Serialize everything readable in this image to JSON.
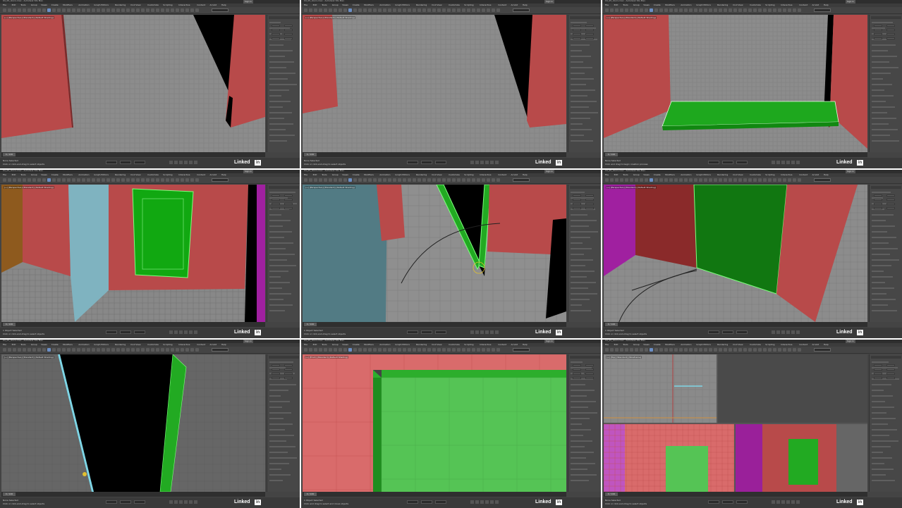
{
  "app": {
    "title": "04_05_doors.max - Autodesk 3ds Max",
    "sign_in": "Sign In",
    "workspace_label": "Workspaces: Default"
  },
  "menus": [
    "File",
    "Edit",
    "Tools",
    "Group",
    "Views",
    "Create",
    "Modifiers",
    "Animation",
    "Graph Editors",
    "Rendering",
    "Civil View",
    "Customize",
    "Scripting",
    "Interactive",
    "Content",
    "Arnold",
    "Help"
  ],
  "viewport_labels": [
    "[+] [Perspective] [Standard] [Default Shading]",
    "[+] [Perspective] [Standard] [Default Shading]",
    "[+] [Perspective] [Standard] [Default Shading]",
    "[+] [Perspective] [Standard] [Default Shading]",
    "[+] [Perspective] [Standard] [Default Shading]",
    "[+] [Perspective] [Standard] [Default Shading]",
    "[+] [Perspective] [Standard] [Default Shading]",
    "[+] [Front] [Standard] [Default Shading]",
    "[+] [Top] [Standard] [Wireframe]"
  ],
  "timeline": {
    "frame": "0 / 100"
  },
  "status": [
    {
      "line1": "None Selected",
      "line2": "Click or click-and-drag to select objects"
    },
    {
      "line1": "None Selected",
      "line2": "Click or click-and-drag to select objects"
    },
    {
      "line1": "None Selected",
      "line2": "Click and drag to begin creation process"
    },
    {
      "line1": "1 Object Selected",
      "line2": "Click or click-and-drag to select objects"
    },
    {
      "line1": "1 Object Selected",
      "line2": "Click or click-and-drag to select objects"
    },
    {
      "line1": "1 Object Selected",
      "line2": "Click or click-and-drag to select objects"
    },
    {
      "line1": "None Selected",
      "line2": "Click or click-and-drag to select objects"
    },
    {
      "line1": "1 Object Selected",
      "line2": "Click and drag to select and move objects"
    },
    {
      "line1": "None Selected",
      "line2": "Click or click-and-drag to select objects"
    }
  ],
  "watermark": {
    "text": "Linked",
    "box": "in"
  },
  "colors": {
    "wall_red": "#b84a4a",
    "door_green": "#22aa22",
    "door_light_green": "#55c455",
    "selected_outline": "#7fff7f",
    "wall_blue": "#7fb3c0",
    "wall_magenta": "#a020a0",
    "floor_gray": "#8a8a8a",
    "black": "#000000"
  }
}
